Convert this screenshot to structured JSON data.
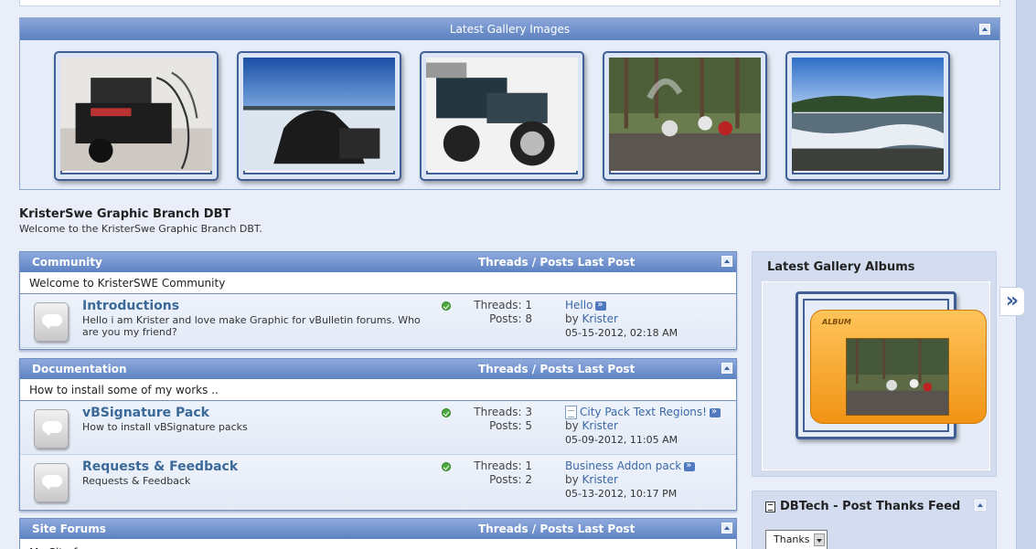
{
  "gallery": {
    "title": "Latest Gallery Images",
    "images": [
      {
        "alt": "Motorcycle in garage"
      },
      {
        "alt": "Motorcycle by frozen lake"
      },
      {
        "alt": "Motorcycle"
      },
      {
        "alt": "Group at campfire in forest"
      },
      {
        "alt": "River rapids"
      }
    ]
  },
  "site": {
    "title": "KristerSwe Graphic Branch DBT",
    "welcome": "Welcome to the KristerSwe Graphic Branch DBT."
  },
  "categories": [
    {
      "name": "Community",
      "columns": "Threads / Posts Last Post",
      "description": "Welcome to KristerSWE Community",
      "forums": [
        {
          "name": "Introductions",
          "description": "Hello i am Krister and love make Graphic for vBulletin forums. Who are you my friend?",
          "threads": "Threads: 1",
          "posts": "Posts: 8",
          "last_title": "Hello",
          "last_by_prefix": "by",
          "last_by": "Krister",
          "last_date": "05-15-2012, 02:18 AM"
        }
      ]
    },
    {
      "name": "Documentation",
      "columns": "Threads / Posts Last Post",
      "description": "How to install some of my works ..",
      "forums": [
        {
          "name": "vBSignature Pack",
          "description": "How to install vBSignature packs",
          "threads": "Threads: 3",
          "posts": "Posts: 5",
          "last_title": "City Pack Text Regions!",
          "last_by_prefix": "by",
          "last_by": "Krister",
          "last_date": "05-09-2012, 11:05 AM"
        },
        {
          "name": "Requests & Feedback",
          "description": "Requests & Feedback",
          "threads": "Threads: 1",
          "posts": "Posts: 2",
          "last_title": "Business Addon pack",
          "last_by_prefix": "by",
          "last_by": "Krister",
          "last_date": "05-13-2012, 10:17 PM"
        }
      ]
    },
    {
      "name": "Site Forums",
      "columns": "Threads / Posts Last Post",
      "description": "My Site forums"
    }
  ],
  "sidebar": {
    "albums_title": "Latest Gallery Albums",
    "album_label": "ALBUM",
    "feed_title": "DBTech - Post Thanks Feed",
    "feed_select": "Thanks"
  },
  "next_glyph": "»"
}
